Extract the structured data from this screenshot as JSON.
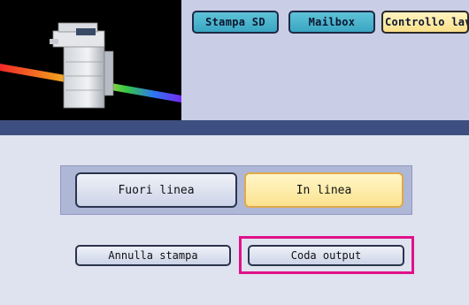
{
  "top_tabs": [
    {
      "label": "Stampa SD"
    },
    {
      "label": "Mailbox"
    },
    {
      "label": "Controllo lavor"
    }
  ],
  "mode_buttons": {
    "offline_label": "Fuori linea",
    "online_label": "In linea",
    "selected": "In linea"
  },
  "job_buttons": {
    "cancel_print_label": "Annulla stampa",
    "output_queue_label": "Coda output"
  },
  "colors": {
    "accent_yellow": "#fbe089",
    "tab_teal": "#3aa6c2",
    "band_blue": "#3d4f80",
    "highlight": "#e0118a"
  }
}
